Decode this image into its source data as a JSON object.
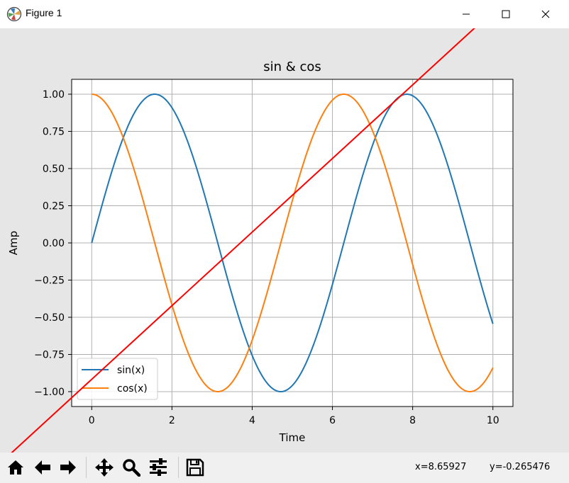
{
  "window": {
    "title": "Figure 1",
    "icon": "matplotlib-icon",
    "controls": [
      "minimize-icon",
      "maximize-icon",
      "close-icon"
    ]
  },
  "toolbar": {
    "buttons": [
      "home-icon",
      "back-arrow-icon",
      "forward-arrow-icon",
      "pan-icon",
      "zoom-icon",
      "subplots-config-icon",
      "save-icon"
    ],
    "coord_x": "x=8.65927",
    "coord_y": "y=-0.265476"
  },
  "colors": {
    "sin": "#1f77b4",
    "cos": "#ff7f0e",
    "overlay_line": "#ff0000",
    "grid": "#b0b0b0"
  },
  "chart_data": {
    "type": "line",
    "title": "sin & cos",
    "xlabel": "Time",
    "ylabel": "Amp",
    "xlim": [
      -0.5,
      10.5
    ],
    "ylim": [
      -1.1,
      1.1
    ],
    "xticks": [
      0,
      2,
      4,
      6,
      8,
      10
    ],
    "xtick_labels": [
      "0",
      "2",
      "4",
      "6",
      "8",
      "10"
    ],
    "yticks": [
      1.0,
      0.75,
      0.5,
      0.25,
      0.0,
      -0.25,
      -0.5,
      -0.75,
      -1.0
    ],
    "ytick_labels": [
      "1.00",
      "0.75",
      "0.50",
      "0.25",
      "0.00",
      "−0.25",
      "−0.50",
      "−0.75",
      "−1.00"
    ],
    "grid": true,
    "legend": "lower-left",
    "series": [
      {
        "name": "sin(x)",
        "function": "sin",
        "x_start": 0,
        "x_end": 10
      },
      {
        "name": "cos(x)",
        "function": "cos",
        "x_start": 0,
        "x_end": 10
      }
    ],
    "overlay_line": {
      "points": [
        [
          -2.8,
          -1.61
        ],
        [
          14.05,
          2.56
        ]
      ]
    }
  }
}
